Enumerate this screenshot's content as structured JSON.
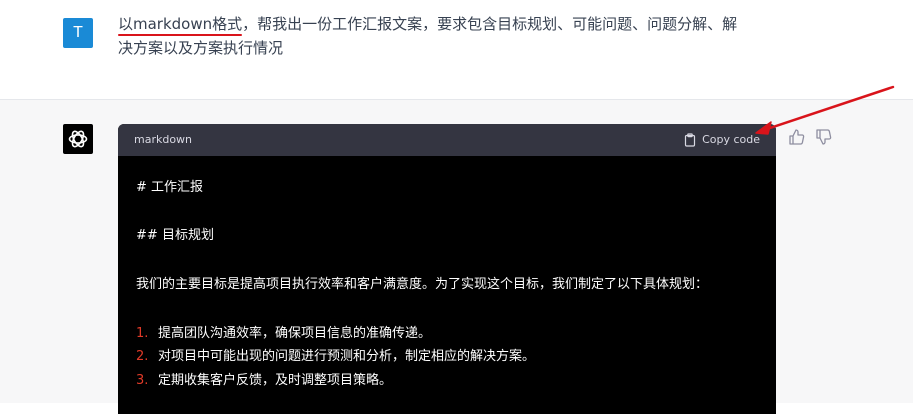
{
  "user": {
    "avatar_letter": "T",
    "message_highlight": "以markdown格式",
    "message_line1_rest": "，帮我出一份工作汇报文案，要求包含目标规划、可能问题、问题分解、解",
    "message_line2": "决方案以及方案执行情况"
  },
  "assistant": {
    "code_language": "markdown",
    "copy_label": "Copy code",
    "lines": {
      "h1": "# 工作汇报",
      "h2_marker": "##",
      "h2_text": "目标规划",
      "para": "我们的主要目标是提高项目执行效率和客户满意度。为了实现这个目标，我们制定了以下具体规划：",
      "items": [
        {
          "num": "1.",
          "text": "提高团队沟通效率，确保项目信息的准确传递。"
        },
        {
          "num": "2.",
          "text": "对项目中可能出现的问题进行预测和分析，制定相应的解决方案。"
        },
        {
          "num": "3.",
          "text": "定期收集客户反馈，及时调整项目策略。"
        }
      ]
    }
  },
  "colors": {
    "annotation": "#d9141b",
    "code_bg": "#000000",
    "code_header_bg": "#343541",
    "list_number": "#e03a28"
  },
  "icons": [
    "chatgpt-logo-icon",
    "clipboard-icon",
    "thumbs-up-icon",
    "thumbs-down-icon",
    "annotation-arrow"
  ]
}
